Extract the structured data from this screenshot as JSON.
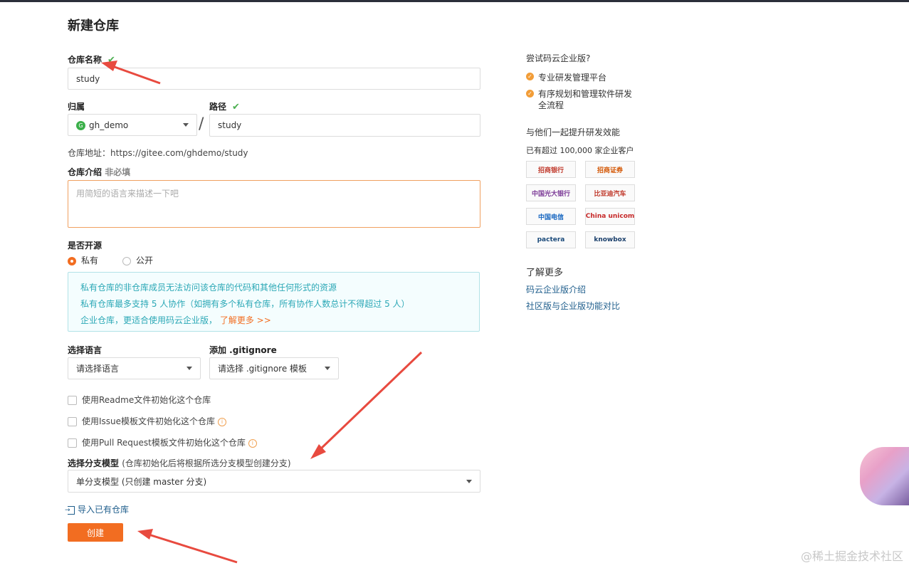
{
  "page_title": "新建仓库",
  "repo_name": {
    "label": "仓库名称",
    "value": "study"
  },
  "owner": {
    "label": "归属",
    "value": "gh_demo",
    "avatar_letter": "G"
  },
  "path": {
    "label": "路径",
    "separator": "/",
    "value": "study"
  },
  "repo_url": {
    "label": "仓库地址：",
    "value": "https://gitee.com/ghdemo/study"
  },
  "description": {
    "label": "仓库介绍",
    "optional": "非必填",
    "placeholder": "用简短的语言来描述一下吧"
  },
  "visibility": {
    "label": "是否开源",
    "private_label": "私有",
    "public_label": "公开",
    "selected": "私有"
  },
  "info": {
    "line1": "私有仓库的非仓库成员无法访问该仓库的代码和其他任何形式的资源",
    "line2": "私有仓库最多支持 5 人协作（如拥有多个私有仓库，所有协作人数总计不得超过 5 人）",
    "line3": "企业仓库，更适合使用码云企业版，",
    "more": "了解更多 >>"
  },
  "language": {
    "label": "选择语言",
    "value": "请选择语言"
  },
  "gitignore": {
    "label": "添加 .gitignore",
    "value": "请选择 .gitignore 模板"
  },
  "init_options": [
    {
      "label": "使用Readme文件初始化这个仓库",
      "info": false
    },
    {
      "label": "使用Issue模板文件初始化这个仓库",
      "info": true
    },
    {
      "label": "使用Pull Request模板文件初始化这个仓库",
      "info": true
    }
  ],
  "branch_model": {
    "label": "选择分支模型",
    "hint": "(仓库初始化后将根据所选分支模型创建分支)",
    "value": "单分支模型 (只创建 master 分支)"
  },
  "import_link": "导入已有仓库",
  "create_button": "创建",
  "sidebar": {
    "try_title": "尝试码云企业版?",
    "features": [
      "专业研发管理平台",
      "有序规划和管理软件研发全流程"
    ],
    "improve_title": "与他们一起提升研发效能",
    "customers_text": "已有超过 100,000 家企业客户",
    "logos": [
      "招商银行",
      "招商证券",
      "中国光大银行",
      "比亚迪汽车",
      "中国电信",
      "China unicom",
      "pactera",
      "knowbox"
    ],
    "learn_more_title": "了解更多",
    "links": [
      "码云企业版介绍",
      "社区版与企业版功能对比"
    ]
  },
  "watermark": "@稀土掘金技术社区",
  "colors": {
    "accent": "#f26d21",
    "info_text": "#2ba8b6",
    "arrow": "#e84a3f",
    "link": "#1f5e8c"
  }
}
